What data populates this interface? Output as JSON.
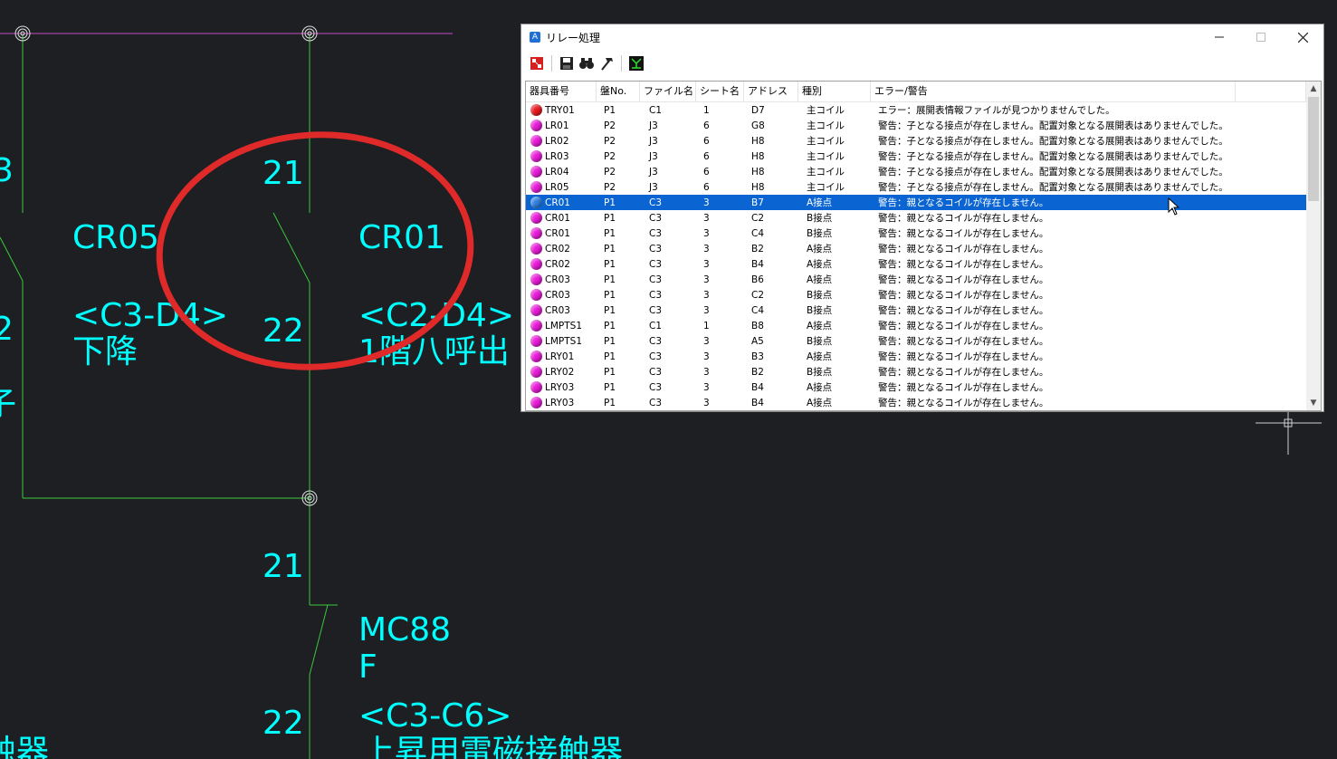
{
  "cad": {
    "labels": {
      "left_3": "3",
      "left_2": "2",
      "left_partial": "子",
      "cr05": "CR05",
      "c3d4": "<C3-D4>",
      "kakou": "下降",
      "n21_top": "21",
      "n22_top": "22",
      "cr01": "CR01",
      "c2d4": "<C2-D4>",
      "floor1": "1階八呼出",
      "n21_bottom": "21",
      "mc88": "MC88",
      "f": "F",
      "n22_bottom": "22",
      "c3c6": "<C3-C6>",
      "jousho": "上昇用電磁接触器",
      "left_bottom": "触器"
    },
    "colors": {
      "text": "#00ffff",
      "wire": "#3cc83c",
      "bus": "#c84ec8",
      "annotation": "#e02a2a",
      "background": "#1d1f23"
    }
  },
  "dialog": {
    "title": "リレー処理",
    "app_icon": "A",
    "icons": [
      "relay-check-icon",
      "save-icon",
      "binoculars-icon",
      "hammer-icon",
      "circuit-icon"
    ],
    "columns": [
      "器具番号",
      "盤No.",
      "ファイル名",
      "シート名",
      "アドレス",
      "種別",
      "エラー/警告"
    ],
    "rows": [
      {
        "dot": "red",
        "id": "TRY01",
        "panel": "P1",
        "file": "C1",
        "sheet": "1",
        "addr": "D7",
        "kind": "主コイル",
        "msg": "エラー：展開表情報ファイルが見つかりませんでした。"
      },
      {
        "dot": "magenta",
        "id": "LR01",
        "panel": "P2",
        "file": "J3",
        "sheet": "6",
        "addr": "G8",
        "kind": "主コイル",
        "msg": "警告：子となる接点が存在しません。配置対象となる展開表はありませんでした。"
      },
      {
        "dot": "magenta",
        "id": "LR02",
        "panel": "P2",
        "file": "J3",
        "sheet": "6",
        "addr": "H8",
        "kind": "主コイル",
        "msg": "警告：子となる接点が存在しません。配置対象となる展開表はありませんでした。"
      },
      {
        "dot": "magenta",
        "id": "LR03",
        "panel": "P2",
        "file": "J3",
        "sheet": "6",
        "addr": "H8",
        "kind": "主コイル",
        "msg": "警告：子となる接点が存在しません。配置対象となる展開表はありませんでした。"
      },
      {
        "dot": "magenta",
        "id": "LR04",
        "panel": "P2",
        "file": "J3",
        "sheet": "6",
        "addr": "H8",
        "kind": "主コイル",
        "msg": "警告：子となる接点が存在しません。配置対象となる展開表はありませんでした。"
      },
      {
        "dot": "magenta",
        "id": "LR05",
        "panel": "P2",
        "file": "J3",
        "sheet": "6",
        "addr": "H8",
        "kind": "主コイル",
        "msg": "警告：子となる接点が存在しません。配置対象となる展開表はありませんでした。"
      },
      {
        "dot": "blue",
        "id": "CR01",
        "panel": "P1",
        "file": "C3",
        "sheet": "3",
        "addr": "B7",
        "kind": "A接点",
        "msg": "警告：親となるコイルが存在しません。",
        "selected": true
      },
      {
        "dot": "magenta",
        "id": "CR01",
        "panel": "P1",
        "file": "C3",
        "sheet": "3",
        "addr": "C2",
        "kind": "B接点",
        "msg": "警告：親となるコイルが存在しません。"
      },
      {
        "dot": "magenta",
        "id": "CR01",
        "panel": "P1",
        "file": "C3",
        "sheet": "3",
        "addr": "C4",
        "kind": "B接点",
        "msg": "警告：親となるコイルが存在しません。"
      },
      {
        "dot": "magenta",
        "id": "CR02",
        "panel": "P1",
        "file": "C3",
        "sheet": "3",
        "addr": "B2",
        "kind": "A接点",
        "msg": "警告：親となるコイルが存在しません。"
      },
      {
        "dot": "magenta",
        "id": "CR02",
        "panel": "P1",
        "file": "C3",
        "sheet": "3",
        "addr": "B4",
        "kind": "A接点",
        "msg": "警告：親となるコイルが存在しません。"
      },
      {
        "dot": "magenta",
        "id": "CR03",
        "panel": "P1",
        "file": "C3",
        "sheet": "3",
        "addr": "B6",
        "kind": "A接点",
        "msg": "警告：親となるコイルが存在しません。"
      },
      {
        "dot": "magenta",
        "id": "CR03",
        "panel": "P1",
        "file": "C3",
        "sheet": "3",
        "addr": "C2",
        "kind": "B接点",
        "msg": "警告：親となるコイルが存在しません。"
      },
      {
        "dot": "magenta",
        "id": "CR03",
        "panel": "P1",
        "file": "C3",
        "sheet": "3",
        "addr": "C4",
        "kind": "B接点",
        "msg": "警告：親となるコイルが存在しません。"
      },
      {
        "dot": "magenta",
        "id": "LMPTS1",
        "panel": "P1",
        "file": "C1",
        "sheet": "1",
        "addr": "B8",
        "kind": "A接点",
        "msg": "警告：親となるコイルが存在しません。"
      },
      {
        "dot": "magenta",
        "id": "LMPTS1",
        "panel": "P1",
        "file": "C3",
        "sheet": "3",
        "addr": "A5",
        "kind": "B接点",
        "msg": "警告：親となるコイルが存在しません。"
      },
      {
        "dot": "magenta",
        "id": "LRY01",
        "panel": "P1",
        "file": "C3",
        "sheet": "3",
        "addr": "B3",
        "kind": "A接点",
        "msg": "警告：親となるコイルが存在しません。"
      },
      {
        "dot": "magenta",
        "id": "LRY02",
        "panel": "P1",
        "file": "C3",
        "sheet": "3",
        "addr": "B2",
        "kind": "B接点",
        "msg": "警告：親となるコイルが存在しません。"
      },
      {
        "dot": "magenta",
        "id": "LRY03",
        "panel": "P1",
        "file": "C3",
        "sheet": "3",
        "addr": "B4",
        "kind": "A接点",
        "msg": "警告：親となるコイルが存在しません。"
      },
      {
        "dot": "magenta",
        "id": "LRY03",
        "panel": "P1",
        "file": "C3",
        "sheet": "3",
        "addr": "B4",
        "kind": "A接点",
        "msg": "警告：親となるコイルが存在しません。"
      }
    ],
    "dot_colors": {
      "red": "#e8191e",
      "magenta": "#e81ad8",
      "blue": "#2f7fe0"
    }
  }
}
